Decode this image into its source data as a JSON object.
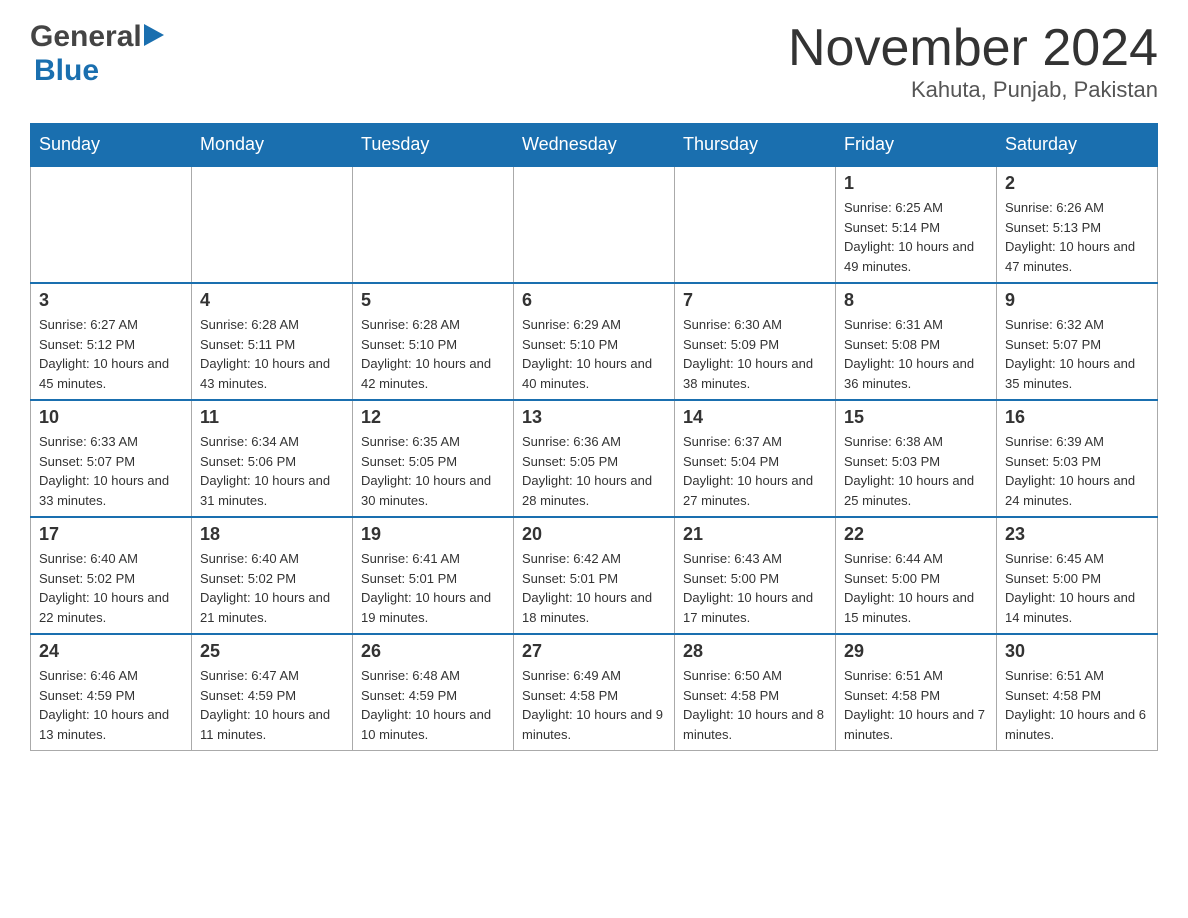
{
  "header": {
    "logo": {
      "general": "General",
      "blue": "Blue"
    },
    "title": "November 2024",
    "location": "Kahuta, Punjab, Pakistan"
  },
  "calendar": {
    "days_of_week": [
      "Sunday",
      "Monday",
      "Tuesday",
      "Wednesday",
      "Thursday",
      "Friday",
      "Saturday"
    ],
    "weeks": [
      [
        {
          "day": "",
          "info": ""
        },
        {
          "day": "",
          "info": ""
        },
        {
          "day": "",
          "info": ""
        },
        {
          "day": "",
          "info": ""
        },
        {
          "day": "",
          "info": ""
        },
        {
          "day": "1",
          "info": "Sunrise: 6:25 AM\nSunset: 5:14 PM\nDaylight: 10 hours and 49 minutes."
        },
        {
          "day": "2",
          "info": "Sunrise: 6:26 AM\nSunset: 5:13 PM\nDaylight: 10 hours and 47 minutes."
        }
      ],
      [
        {
          "day": "3",
          "info": "Sunrise: 6:27 AM\nSunset: 5:12 PM\nDaylight: 10 hours and 45 minutes."
        },
        {
          "day": "4",
          "info": "Sunrise: 6:28 AM\nSunset: 5:11 PM\nDaylight: 10 hours and 43 minutes."
        },
        {
          "day": "5",
          "info": "Sunrise: 6:28 AM\nSunset: 5:10 PM\nDaylight: 10 hours and 42 minutes."
        },
        {
          "day": "6",
          "info": "Sunrise: 6:29 AM\nSunset: 5:10 PM\nDaylight: 10 hours and 40 minutes."
        },
        {
          "day": "7",
          "info": "Sunrise: 6:30 AM\nSunset: 5:09 PM\nDaylight: 10 hours and 38 minutes."
        },
        {
          "day": "8",
          "info": "Sunrise: 6:31 AM\nSunset: 5:08 PM\nDaylight: 10 hours and 36 minutes."
        },
        {
          "day": "9",
          "info": "Sunrise: 6:32 AM\nSunset: 5:07 PM\nDaylight: 10 hours and 35 minutes."
        }
      ],
      [
        {
          "day": "10",
          "info": "Sunrise: 6:33 AM\nSunset: 5:07 PM\nDaylight: 10 hours and 33 minutes."
        },
        {
          "day": "11",
          "info": "Sunrise: 6:34 AM\nSunset: 5:06 PM\nDaylight: 10 hours and 31 minutes."
        },
        {
          "day": "12",
          "info": "Sunrise: 6:35 AM\nSunset: 5:05 PM\nDaylight: 10 hours and 30 minutes."
        },
        {
          "day": "13",
          "info": "Sunrise: 6:36 AM\nSunset: 5:05 PM\nDaylight: 10 hours and 28 minutes."
        },
        {
          "day": "14",
          "info": "Sunrise: 6:37 AM\nSunset: 5:04 PM\nDaylight: 10 hours and 27 minutes."
        },
        {
          "day": "15",
          "info": "Sunrise: 6:38 AM\nSunset: 5:03 PM\nDaylight: 10 hours and 25 minutes."
        },
        {
          "day": "16",
          "info": "Sunrise: 6:39 AM\nSunset: 5:03 PM\nDaylight: 10 hours and 24 minutes."
        }
      ],
      [
        {
          "day": "17",
          "info": "Sunrise: 6:40 AM\nSunset: 5:02 PM\nDaylight: 10 hours and 22 minutes."
        },
        {
          "day": "18",
          "info": "Sunrise: 6:40 AM\nSunset: 5:02 PM\nDaylight: 10 hours and 21 minutes."
        },
        {
          "day": "19",
          "info": "Sunrise: 6:41 AM\nSunset: 5:01 PM\nDaylight: 10 hours and 19 minutes."
        },
        {
          "day": "20",
          "info": "Sunrise: 6:42 AM\nSunset: 5:01 PM\nDaylight: 10 hours and 18 minutes."
        },
        {
          "day": "21",
          "info": "Sunrise: 6:43 AM\nSunset: 5:00 PM\nDaylight: 10 hours and 17 minutes."
        },
        {
          "day": "22",
          "info": "Sunrise: 6:44 AM\nSunset: 5:00 PM\nDaylight: 10 hours and 15 minutes."
        },
        {
          "day": "23",
          "info": "Sunrise: 6:45 AM\nSunset: 5:00 PM\nDaylight: 10 hours and 14 minutes."
        }
      ],
      [
        {
          "day": "24",
          "info": "Sunrise: 6:46 AM\nSunset: 4:59 PM\nDaylight: 10 hours and 13 minutes."
        },
        {
          "day": "25",
          "info": "Sunrise: 6:47 AM\nSunset: 4:59 PM\nDaylight: 10 hours and 11 minutes."
        },
        {
          "day": "26",
          "info": "Sunrise: 6:48 AM\nSunset: 4:59 PM\nDaylight: 10 hours and 10 minutes."
        },
        {
          "day": "27",
          "info": "Sunrise: 6:49 AM\nSunset: 4:58 PM\nDaylight: 10 hours and 9 minutes."
        },
        {
          "day": "28",
          "info": "Sunrise: 6:50 AM\nSunset: 4:58 PM\nDaylight: 10 hours and 8 minutes."
        },
        {
          "day": "29",
          "info": "Sunrise: 6:51 AM\nSunset: 4:58 PM\nDaylight: 10 hours and 7 minutes."
        },
        {
          "day": "30",
          "info": "Sunrise: 6:51 AM\nSunset: 4:58 PM\nDaylight: 10 hours and 6 minutes."
        }
      ]
    ]
  }
}
